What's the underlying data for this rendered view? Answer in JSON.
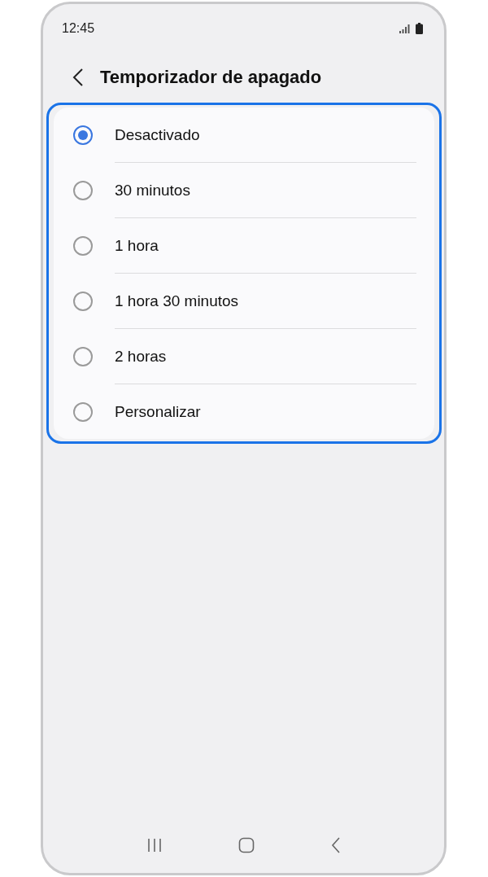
{
  "status_bar": {
    "time": "12:45"
  },
  "header": {
    "title": "Temporizador de apagado"
  },
  "options": [
    {
      "label": "Desactivado",
      "selected": true
    },
    {
      "label": "30 minutos",
      "selected": false
    },
    {
      "label": "1 hora",
      "selected": false
    },
    {
      "label": "1 hora 30 minutos",
      "selected": false
    },
    {
      "label": "2 horas",
      "selected": false
    },
    {
      "label": "Personalizar",
      "selected": false
    }
  ]
}
